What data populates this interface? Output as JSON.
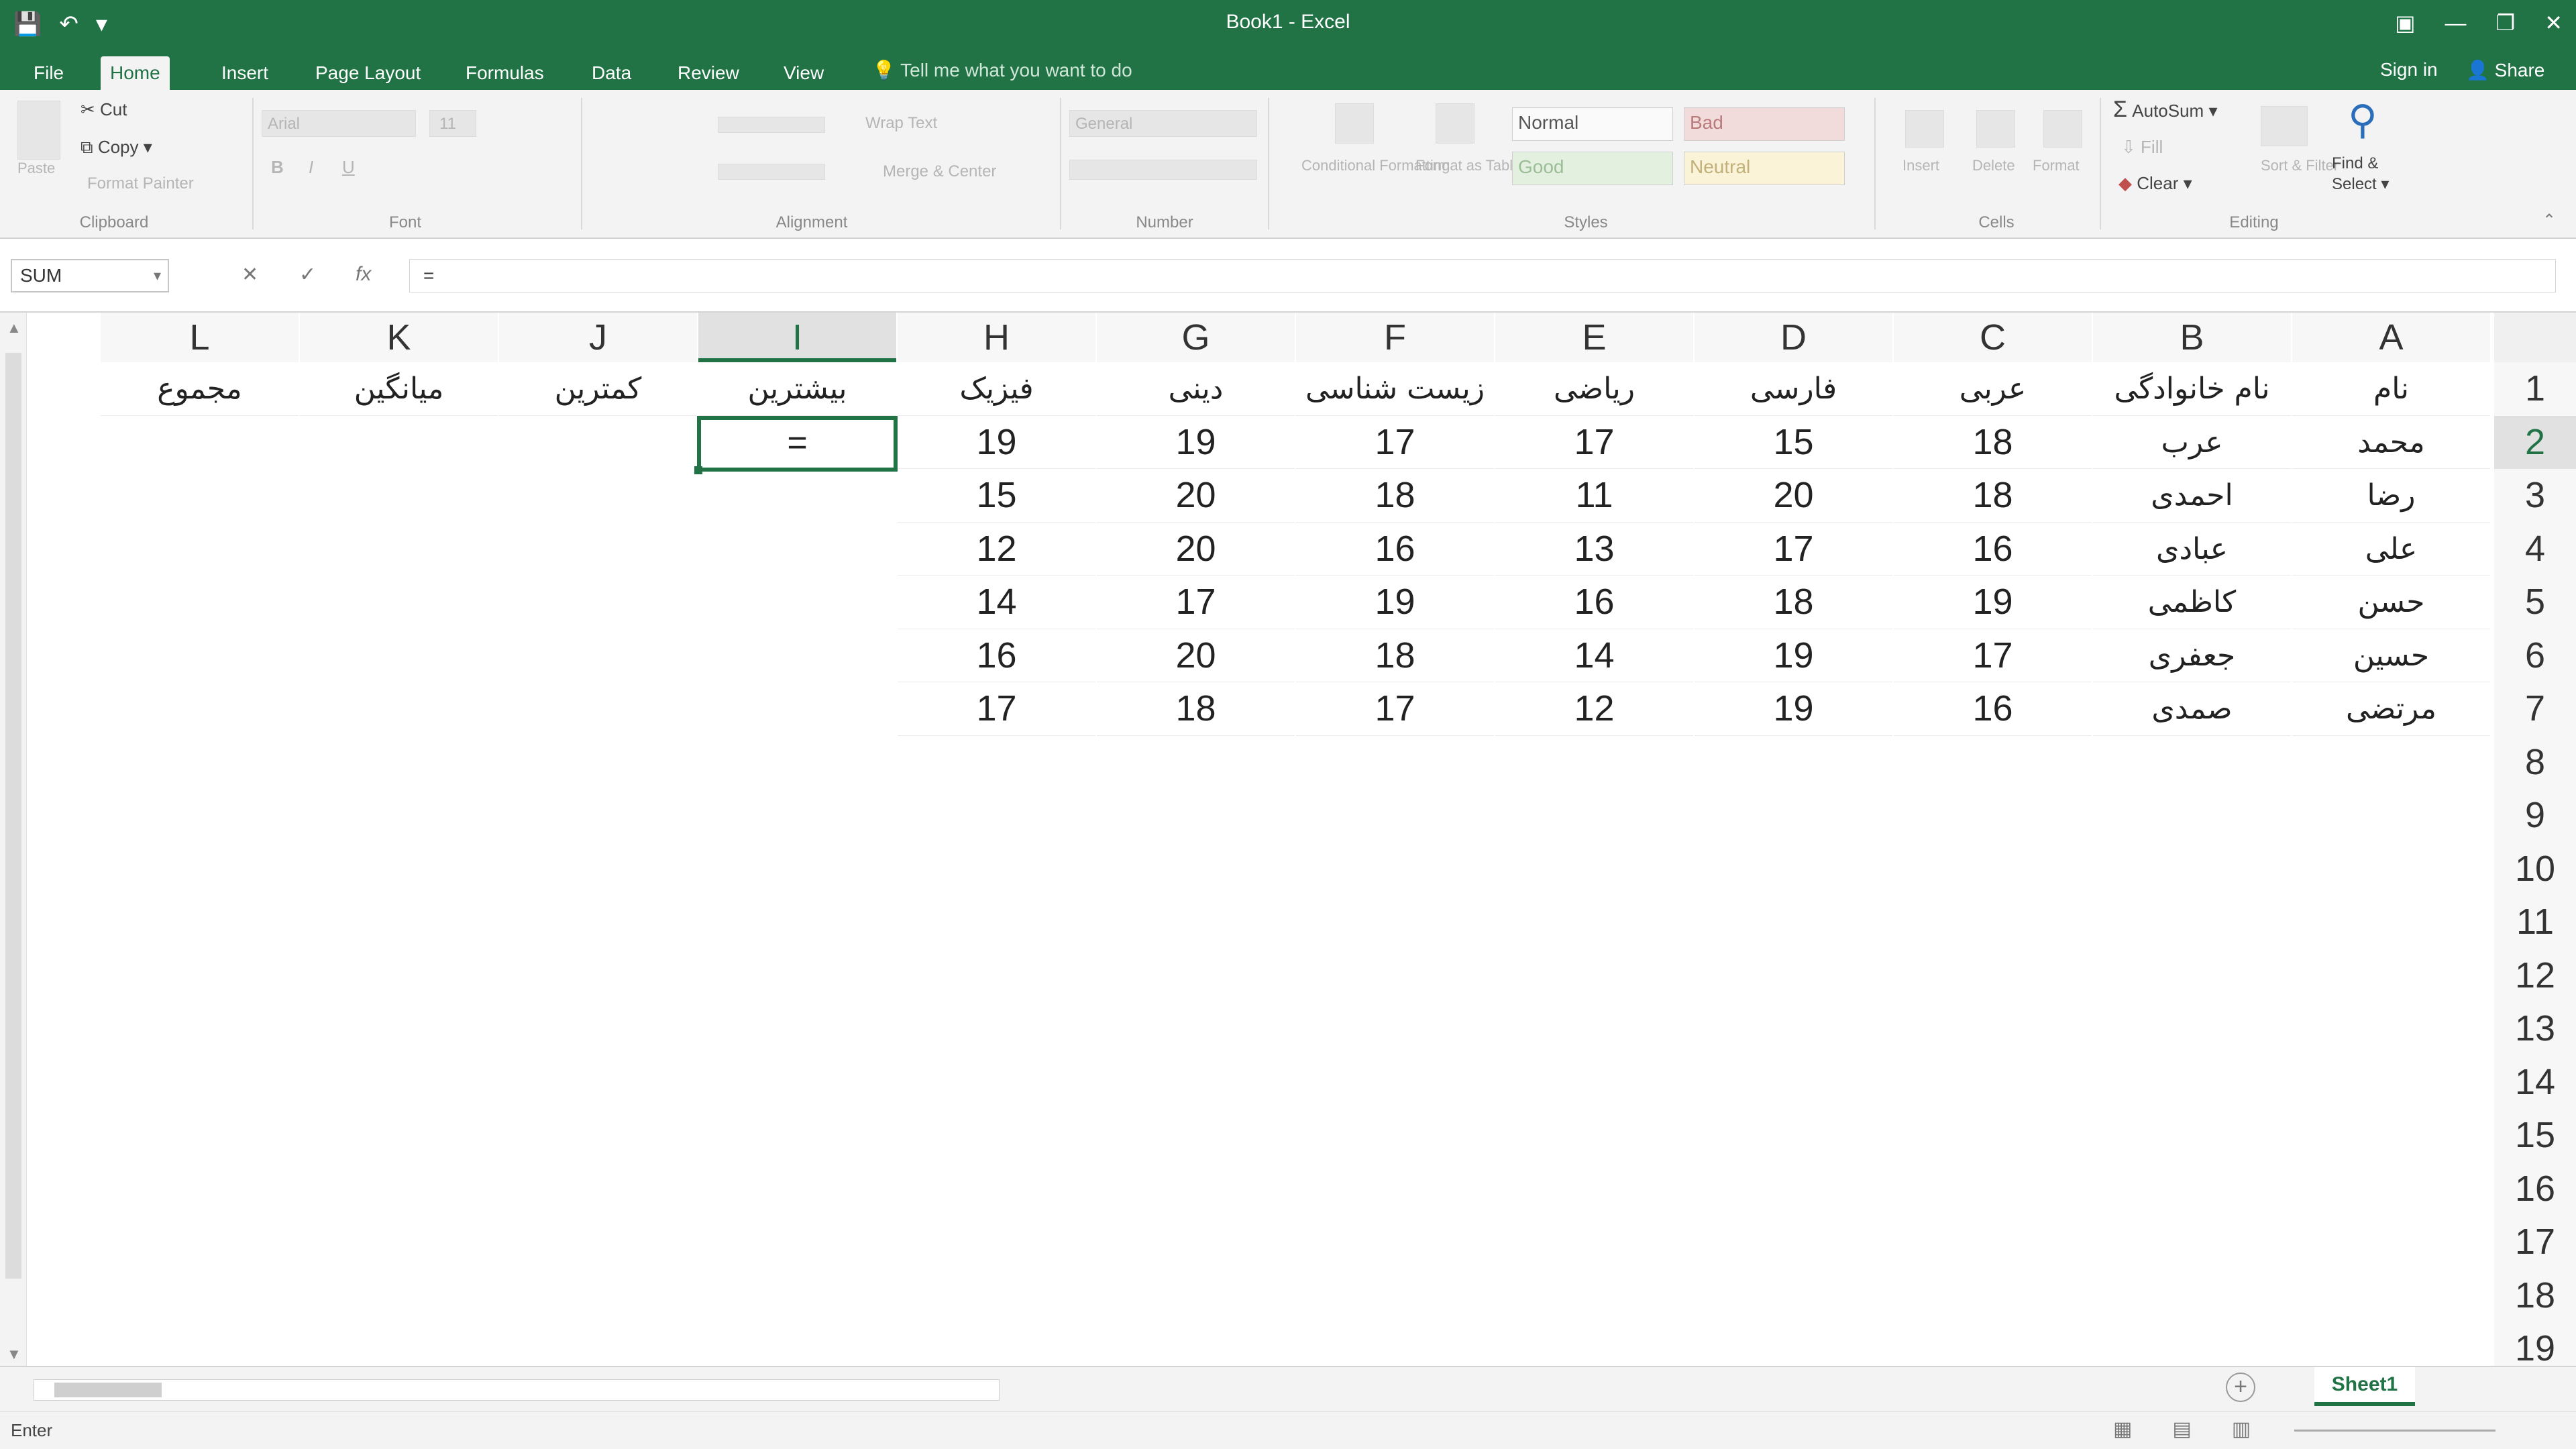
{
  "window": {
    "title": "Book1 - Excel",
    "quick_access": {
      "save_icon": "save-icon",
      "undo_icon": "undo-icon",
      "customize_icon": "customize-qat-icon"
    },
    "controls": {
      "ribbon_options": "▣",
      "minimize": "—",
      "restore": "❐",
      "close": "✕"
    }
  },
  "ribbon_tabs": [
    "File",
    "Home",
    "Insert",
    "Page Layout",
    "Formulas",
    "Data",
    "Review",
    "View"
  ],
  "active_tab": "Home",
  "tell_me": "Tell me what you want to do",
  "account": {
    "signin": "Sign in",
    "share": "Share"
  },
  "ribbon": {
    "clipboard": {
      "label": "Clipboard",
      "paste": "Paste",
      "cut": "Cut",
      "copy": "Copy",
      "format_painter": "Format Painter"
    },
    "font": {
      "label": "Font",
      "name": "Arial",
      "size": "11",
      "bold": "B",
      "italic": "I",
      "underline": "U"
    },
    "alignment": {
      "label": "Alignment",
      "wrap": "Wrap Text",
      "merge": "Merge & Center"
    },
    "number": {
      "label": "Number",
      "format": "General"
    },
    "styles": {
      "label": "Styles",
      "conditional": "Conditional Formatting",
      "format_as_table": "Format as Table",
      "normal": "Normal",
      "bad": "Bad",
      "good": "Good",
      "neutral": "Neutral"
    },
    "cells": {
      "label": "Cells",
      "insert": "Insert",
      "delete": "Delete",
      "format": "Format"
    },
    "editing": {
      "label": "Editing",
      "autosum": "AutoSum",
      "fill": "Fill",
      "clear": "Clear",
      "sort": "Sort & Filter",
      "find_select_1": "Find &",
      "find_select_2": "Select"
    }
  },
  "formula_bar": {
    "name_box": "SUM",
    "cancel": "✕",
    "enter": "✓",
    "fx": "fx",
    "content": "="
  },
  "columns": [
    "L",
    "K",
    "J",
    "I",
    "H",
    "G",
    "F",
    "E",
    "D",
    "C",
    "B",
    "A"
  ],
  "selected_column": "I",
  "rows": [
    "1",
    "2",
    "3",
    "4",
    "5",
    "6",
    "7",
    "8",
    "9",
    "10",
    "11",
    "12",
    "13",
    "14",
    "15",
    "16",
    "17",
    "18",
    "19"
  ],
  "selected_row": "2",
  "sheet": {
    "headers": {
      "A": "نام",
      "B": "نام خانوادگی",
      "C": "عربی",
      "D": "فارسی",
      "E": "ریاضی",
      "F": "زیست شناسی",
      "G": "دینی",
      "H": "فیزیک",
      "I": "بیشترین",
      "J": "کمترین",
      "K": "میانگین",
      "L": "مجموع"
    },
    "records": [
      {
        "A": "محمد",
        "B": "عرب",
        "C": "18",
        "D": "15",
        "E": "17",
        "F": "17",
        "G": "19",
        "H": "19"
      },
      {
        "A": "رضا",
        "B": "احمدی",
        "C": "18",
        "D": "20",
        "E": "11",
        "F": "18",
        "G": "20",
        "H": "15"
      },
      {
        "A": "علی",
        "B": "عبادی",
        "C": "16",
        "D": "17",
        "E": "13",
        "F": "16",
        "G": "20",
        "H": "12"
      },
      {
        "A": "حسن",
        "B": "کاظمی",
        "C": "19",
        "D": "18",
        "E": "16",
        "F": "19",
        "G": "17",
        "H": "14"
      },
      {
        "A": "حسین",
        "B": "جعفری",
        "C": "17",
        "D": "19",
        "E": "14",
        "F": "18",
        "G": "20",
        "H": "16"
      },
      {
        "A": "مرتضی",
        "B": "صمدی",
        "C": "16",
        "D": "19",
        "E": "12",
        "F": "17",
        "G": "18",
        "H": "17"
      }
    ],
    "active_cell_text": "="
  },
  "sheet_tabs": [
    "Sheet1"
  ],
  "status": {
    "mode": "Enter"
  }
}
